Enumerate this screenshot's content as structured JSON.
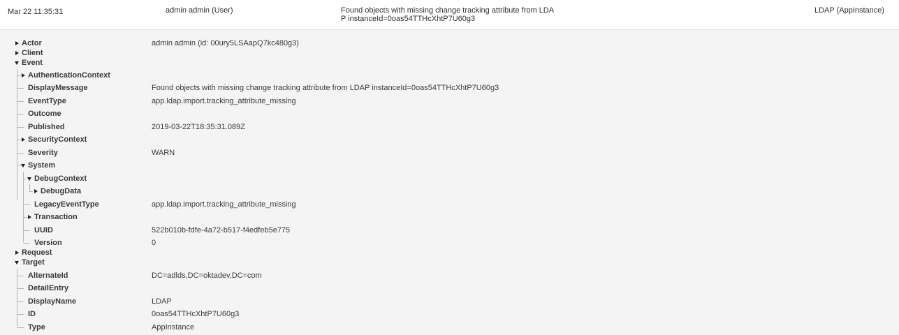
{
  "header": {
    "time": "Mar 22 11:35:31",
    "actor": "admin admin  (User)",
    "message": "Found objects with missing change tracking attribute from LDAP instanceId=0oas54TTHcXhtP7U60g3",
    "target": "LDAP  (AppInstance)"
  },
  "tree": {
    "actor": {
      "label": "Actor",
      "value": "admin admin (id: 00ury5LSAapQ7kc480g3)"
    },
    "client": {
      "label": "Client"
    },
    "event": {
      "label": "Event",
      "authentication_context": {
        "label": "AuthenticationContext"
      },
      "display_message": {
        "label": "DisplayMessage",
        "value": "Found objects with missing change tracking attribute from LDAP instanceId=0oas54TTHcXhtP7U60g3"
      },
      "event_type": {
        "label": "EventType",
        "value": "app.ldap.import.tracking_attribute_missing"
      },
      "outcome": {
        "label": "Outcome"
      },
      "published": {
        "label": "Published",
        "value": "2019-03-22T18:35:31.089Z"
      },
      "security_context": {
        "label": "SecurityContext"
      },
      "severity": {
        "label": "Severity",
        "value": "WARN"
      },
      "system": {
        "label": "System",
        "debug_context": {
          "label": "DebugContext"
        },
        "debug_data": {
          "label": "DebugData"
        },
        "legacy_event_type": {
          "label": "LegacyEventType",
          "value": "app.ldap.import.tracking_attribute_missing"
        },
        "transaction": {
          "label": "Transaction"
        },
        "uuid": {
          "label": "UUID",
          "value": "522b010b-fdfe-4a72-b517-f4edfeb5e775"
        },
        "version": {
          "label": "Version",
          "value": "0"
        }
      }
    },
    "request": {
      "label": "Request"
    },
    "target": {
      "label": "Target",
      "alternate_id": {
        "label": "AlternateId",
        "value": "DC=adlds,DC=oktadev,DC=com"
      },
      "detail_entry": {
        "label": "DetailEntry"
      },
      "display_name": {
        "label": "DisplayName",
        "value": "LDAP"
      },
      "id": {
        "label": "ID",
        "value": "0oas54TTHcXhtP7U60g3"
      },
      "type": {
        "label": "Type",
        "value": "AppInstance"
      }
    }
  }
}
